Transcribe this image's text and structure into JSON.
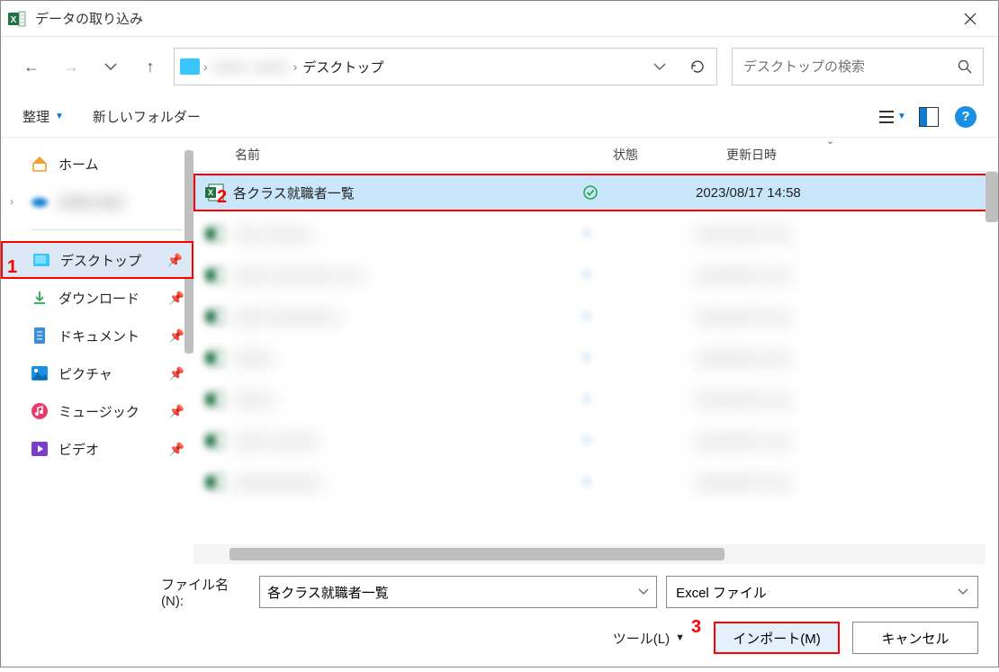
{
  "title": "データの取り込み",
  "addr": {
    "crumb_visible": "デスクトップ"
  },
  "search": {
    "placeholder": "デスクトップの検索"
  },
  "toolbar": {
    "organize": "整理",
    "newfolder": "新しいフォルダー"
  },
  "sidebar": {
    "home": "ホーム",
    "desktop": "デスクトップ",
    "downloads": "ダウンロード",
    "documents": "ドキュメント",
    "pictures": "ピクチャ",
    "music": "ミュージック",
    "videos": "ビデオ"
  },
  "cols": {
    "name": "名前",
    "state": "状態",
    "date": "更新日時"
  },
  "rows": {
    "sel_name": "各クラス就職者一覧",
    "sel_date": "2023/08/17 14:58"
  },
  "footer": {
    "fname_label": "ファイル名(N):",
    "fname_value": "各クラス就職者一覧",
    "filter_value": "Excel ファイル",
    "tools": "ツール(L)",
    "import": "インポート(M)",
    "cancel": "キャンセル"
  },
  "anno": {
    "a1": "1",
    "a2": "2",
    "a3": "3"
  }
}
